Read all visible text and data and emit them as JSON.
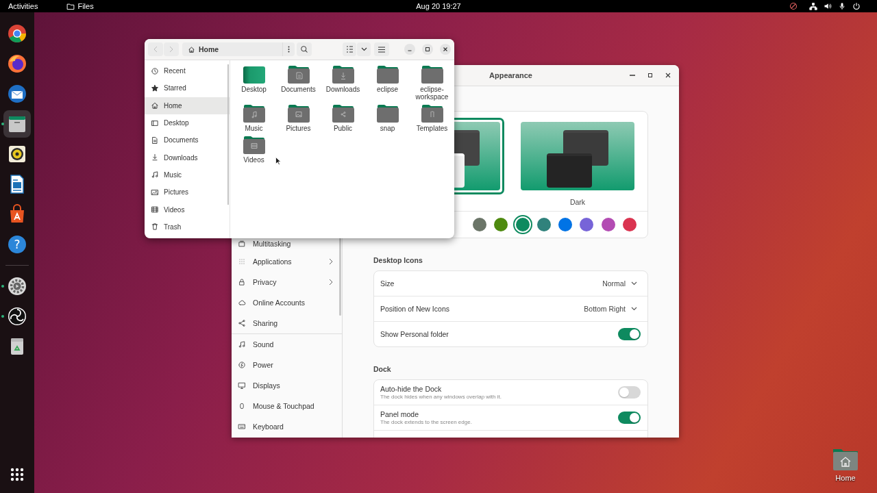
{
  "top_bar": {
    "activities": "Activities",
    "app_menu": "Files",
    "clock": "Aug 20  19:27"
  },
  "dock": [
    {
      "kind": "browser",
      "running": false,
      "selected": false
    },
    {
      "kind": "fox",
      "running": false,
      "selected": false
    },
    {
      "kind": "mail",
      "running": false,
      "selected": false
    },
    {
      "kind": "files",
      "running": true,
      "selected": true
    },
    {
      "kind": "audio",
      "running": false,
      "selected": false
    },
    {
      "kind": "writer",
      "running": false,
      "selected": false
    },
    {
      "kind": "store",
      "running": false,
      "selected": false
    },
    {
      "kind": "help",
      "glyph": "?",
      "running": false,
      "selected": false
    },
    {
      "kind": "settings",
      "running": true,
      "selected": false
    },
    {
      "kind": "rings",
      "running": true,
      "selected": false
    },
    {
      "kind": "trash",
      "running": false,
      "selected": false
    }
  ],
  "settings_window": {
    "title": "Appearance",
    "sidebar": [
      {
        "label": "Multitasking",
        "kind": "multitask",
        "submenu": false,
        "selected": false
      },
      {
        "label": "Applications",
        "kind": "apps",
        "submenu": true,
        "selected": false
      },
      {
        "label": "Privacy",
        "kind": "lock",
        "submenu": true,
        "selected": false
      },
      {
        "label": "Online Accounts",
        "kind": "cloud",
        "submenu": false,
        "selected": false
      },
      {
        "label": "Sharing",
        "kind": "share",
        "submenu": false,
        "selected": false
      },
      {
        "label": "Sound",
        "kind": "note",
        "submenu": false,
        "selected": false
      },
      {
        "label": "Power",
        "kind": "power",
        "submenu": false,
        "selected": false
      },
      {
        "label": "Displays",
        "kind": "monitor",
        "submenu": false,
        "selected": false
      },
      {
        "label": "Mouse & Touchpad",
        "kind": "mouse",
        "submenu": false,
        "selected": false
      },
      {
        "label": "Keyboard",
        "kind": "keyboard",
        "submenu": false,
        "selected": false
      }
    ],
    "styles": [
      {
        "kind": "light",
        "selected": true
      },
      {
        "kind": "dark",
        "label": "Dark",
        "selected": false
      }
    ],
    "accent_colors": [
      {
        "color": "#6b7568",
        "selected": false
      },
      {
        "color": "#4e8a0f",
        "selected": false
      },
      {
        "color": "#0e8a5f",
        "selected": true
      },
      {
        "color": "#30827c",
        "selected": false
      },
      {
        "color": "#0073e5",
        "selected": false
      },
      {
        "color": "#7764d8",
        "selected": false
      },
      {
        "color": "#b34cb3",
        "selected": false
      },
      {
        "color": "#da3450",
        "selected": false
      }
    ],
    "sections": [
      {
        "heading": "Desktop Icons",
        "rows": [
          {
            "kind": "dropdown",
            "label": "Size",
            "value": "Normal"
          },
          {
            "kind": "dropdown",
            "label": "Position of New Icons",
            "value": "Bottom Right"
          },
          {
            "kind": "switch",
            "label": "Show Personal folder",
            "on": true
          }
        ]
      },
      {
        "heading": "Dock",
        "rows": [
          {
            "kind": "switch",
            "label": "Auto-hide the Dock",
            "subtitle": "The dock hides when any windows overlap with it.",
            "on": false
          },
          {
            "kind": "switch",
            "label": "Panel mode",
            "subtitle": "The dock extends to the screen edge.",
            "on": true
          }
        ]
      }
    ]
  },
  "files_window": {
    "path": "Home",
    "sidebar": [
      {
        "label": "Recent",
        "kind": "clock",
        "selected": false
      },
      {
        "label": "Starred",
        "kind": "star",
        "selected": false
      },
      {
        "label": "Home",
        "kind": "home",
        "selected": true
      },
      {
        "label": "Desktop",
        "kind": "desktop",
        "selected": false
      },
      {
        "label": "Documents",
        "kind": "doc",
        "selected": false
      },
      {
        "label": "Downloads",
        "kind": "download",
        "selected": false
      },
      {
        "label": "Music",
        "kind": "note",
        "selected": false
      },
      {
        "label": "Pictures",
        "kind": "image",
        "selected": false
      },
      {
        "label": "Videos",
        "kind": "film",
        "selected": false
      },
      {
        "label": "Trash",
        "kind": "trash",
        "selected": false
      }
    ],
    "items": [
      {
        "label": "Desktop",
        "kind": "desktop"
      },
      {
        "label": "Documents",
        "kind": "doc"
      },
      {
        "label": "Downloads",
        "kind": "download"
      },
      {
        "label": "eclipse",
        "kind": "plain"
      },
      {
        "label": "eclipse-workspace",
        "kind": "plain"
      },
      {
        "label": "Music",
        "kind": "note"
      },
      {
        "label": "Pictures",
        "kind": "image"
      },
      {
        "label": "Public",
        "kind": "share"
      },
      {
        "label": "snap",
        "kind": "plain"
      },
      {
        "label": "Templates",
        "kind": "template"
      },
      {
        "label": "Videos",
        "kind": "film"
      }
    ]
  },
  "desktop_icons": [
    {
      "label": "Home"
    }
  ]
}
